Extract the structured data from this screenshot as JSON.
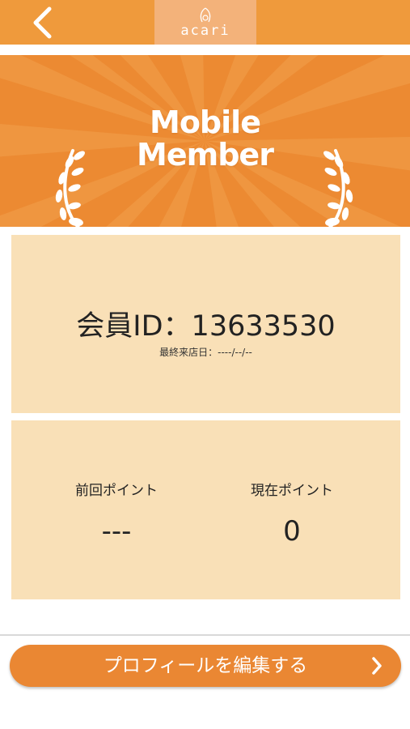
{
  "header": {
    "back_icon": "chevron-left-icon",
    "logo_text": "acari",
    "colors": {
      "bar": "#ef9a3c",
      "logo_box": "#f3b27a"
    }
  },
  "hero": {
    "title_line1": "Mobile",
    "title_line2": "Member",
    "icons": [
      "laurel-left-icon",
      "laurel-right-icon"
    ],
    "colors": {
      "background": "#ec8a32",
      "ray": "#f09a45"
    }
  },
  "member_card": {
    "member_id": "会員ID：13633530",
    "last_visit": "最終来店日：----/--/--",
    "color": "#f9e0b7"
  },
  "points_card": {
    "previous_label": "前回ポイント",
    "previous_value": "---",
    "current_label": "現在ポイント",
    "current_value": "0"
  },
  "profile_button": {
    "label": "プロフィールを編集する",
    "icon": "chevron-right-icon",
    "color": "#ea8733"
  }
}
